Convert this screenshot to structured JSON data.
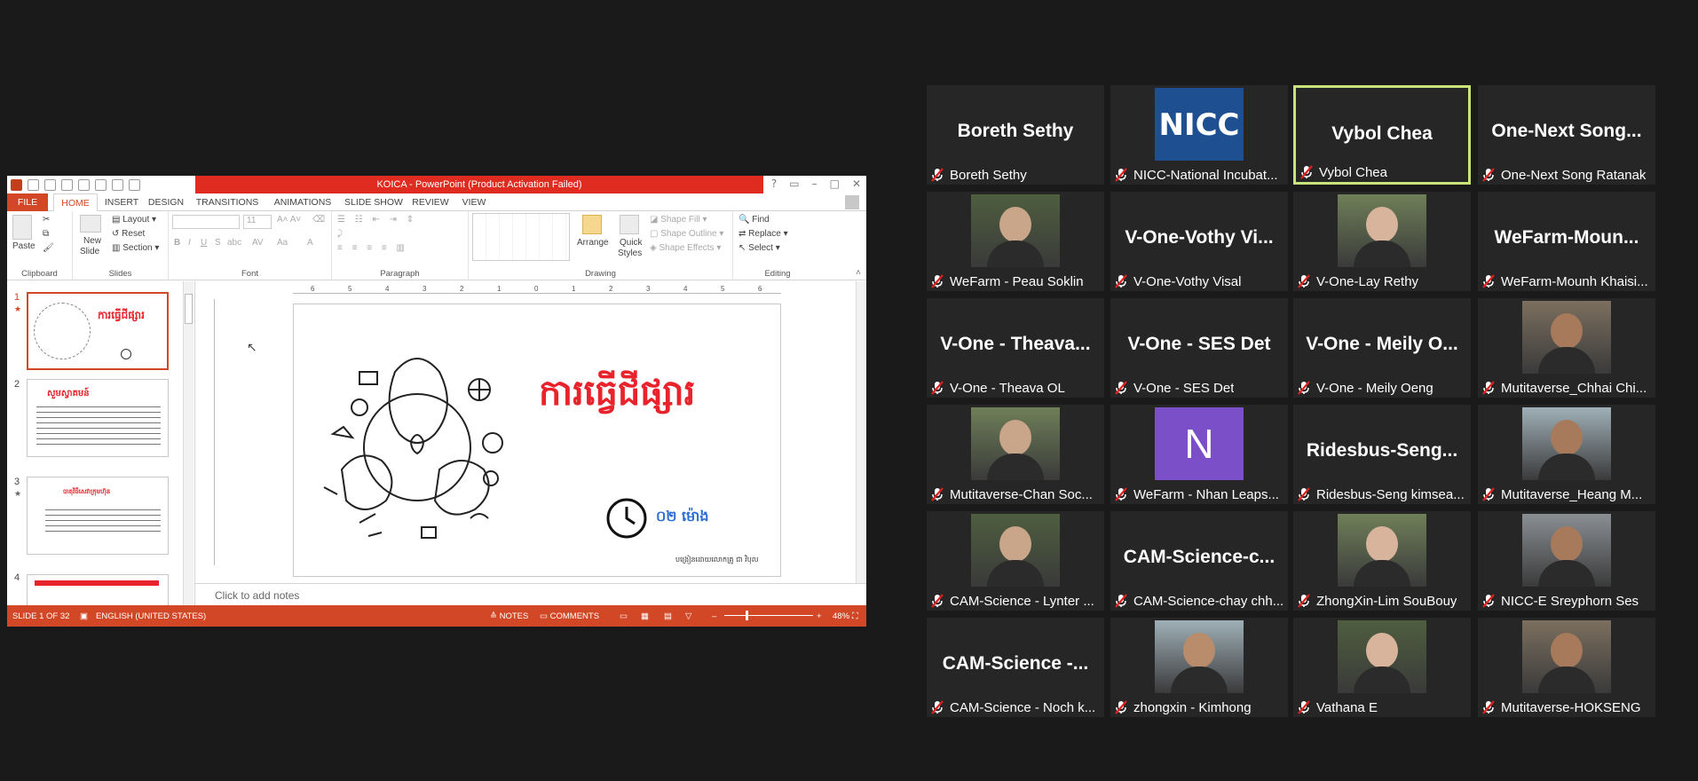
{
  "ppt": {
    "title": "KOICA -  PowerPoint (Product Activation Failed)",
    "tabs": [
      "FILE",
      "HOME",
      "INSERT",
      "DESIGN",
      "TRANSITIONS",
      "ANIMATIONS",
      "SLIDE SHOW",
      "REVIEW",
      "VIEW"
    ],
    "active_tab": "HOME",
    "ribbon": {
      "clipboard": {
        "paste": "Paste",
        "label": "Clipboard"
      },
      "slides": {
        "new_slide": "New",
        "new_slide2": "Slide",
        "layout": "Layout",
        "reset": "Reset",
        "section": "Section",
        "label": "Slides"
      },
      "font": {
        "size": "11",
        "label": "Font"
      },
      "paragraph": {
        "label": "Paragraph"
      },
      "drawing": {
        "arrange": "Arrange",
        "quick": "Quick",
        "styles": "Styles",
        "shape_fill": "Shape Fill",
        "shape_outline": "Shape Outline",
        "shape_effects": "Shape Effects",
        "label": "Drawing"
      },
      "editing": {
        "find": "Find",
        "replace": "Replace",
        "select": "Select",
        "label": "Editing"
      }
    },
    "thumb_numbers": [
      "1",
      "2",
      "3",
      "4"
    ],
    "thumbs": {
      "t1_title": "ការធ្វើជីផ្សារ",
      "t2_title": "សួមស្វាគមន៍",
      "t3_title": "បាតុវិធីសេវាក្រុមហ៊ុន"
    },
    "slide": {
      "title": "ការធ្វើជីផ្សារ",
      "duration": "០២ ម៉ោង",
      "author": "បង្រៀនដោយលោកគ្រូ ជា វិបុល"
    },
    "ruler_ticks": [
      "6",
      "5",
      "4",
      "3",
      "2",
      "1",
      "0",
      "1",
      "2",
      "3",
      "4",
      "5",
      "6"
    ],
    "notes_placeholder": "Click to add notes",
    "status": {
      "slide": "SLIDE 1 OF 32",
      "language": "ENGLISH (UNITED STATES)",
      "notes": "NOTES",
      "comments": "COMMENTS",
      "zoom": "48%",
      "zoom_fraction": 0.48
    }
  },
  "participants": [
    {
      "display": "Boreth Sethy",
      "name": "Boreth Sethy",
      "video": false
    },
    {
      "display": "NICC",
      "name": "NICC-National Incubat...",
      "video": true,
      "logo": true
    },
    {
      "display": "Vybol Chea",
      "name": "Vybol Chea",
      "video": false,
      "speaker": true
    },
    {
      "display": "One-Next Song...",
      "name": "One-Next Song Ratanak",
      "video": false
    },
    {
      "display": "",
      "name": "WeFarm - Peau Soklin",
      "video": true
    },
    {
      "display": "V-One-Vothy Vi...",
      "name": "V-One-Vothy Visal",
      "video": false
    },
    {
      "display": "",
      "name": "V-One-Lay Rethy",
      "video": true
    },
    {
      "display": "WeFarm-Moun...",
      "name": "WeFarm-Mounh Khaisi...",
      "video": false
    },
    {
      "display": "V-One - Theava...",
      "name": "V-One - Theava OL",
      "video": false
    },
    {
      "display": "V-One - SES Det",
      "name": "V-One - SES Det",
      "video": false
    },
    {
      "display": "V-One - Meily O...",
      "name": "V-One - Meily Oeng",
      "video": false
    },
    {
      "display": "",
      "name": "Mutitaverse_Chhai Chi...",
      "video": true
    },
    {
      "display": "",
      "name": "Mutitaverse-Chan Soc...",
      "video": true
    },
    {
      "display": "N",
      "name": "WeFarm - Nhan Leaps...",
      "video": true,
      "initial": true
    },
    {
      "display": "Ridesbus-Seng...",
      "name": "Ridesbus-Seng kimsea...",
      "video": false
    },
    {
      "display": "",
      "name": "Mutitaverse_Heang M...",
      "video": true
    },
    {
      "display": "",
      "name": "CAM-Science - Lynter ...",
      "video": true
    },
    {
      "display": "CAM-Science-c...",
      "name": "CAM-Science-chay chh...",
      "video": false
    },
    {
      "display": "",
      "name": "ZhongXin-Lim SouBouy",
      "video": true
    },
    {
      "display": "",
      "name": "NICC-E Sreyphorn Ses",
      "video": true
    },
    {
      "display": "CAM-Science -...",
      "name": "CAM-Science - Noch k...",
      "video": false
    },
    {
      "display": "",
      "name": "zhongxin - Kimhong",
      "video": true
    },
    {
      "display": "",
      "name": "Vathana E",
      "video": true
    },
    {
      "display": "",
      "name": "Mutitaverse-HOKSENG",
      "video": true
    }
  ],
  "colors": {
    "accent": "#d24726",
    "title_red": "#e02b20",
    "speaker_border": "#c9e37a",
    "mute_red": "#e02020",
    "background": "#1a1a1a",
    "tile": "#262626"
  }
}
